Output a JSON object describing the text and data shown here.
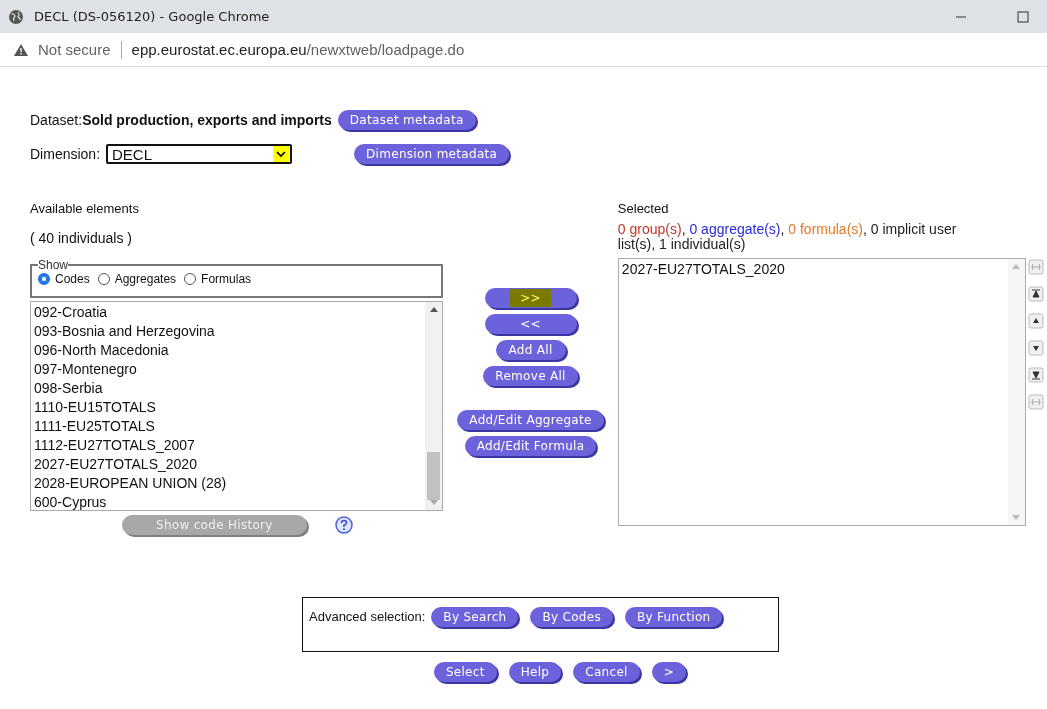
{
  "window": {
    "title": "DECL (DS-056120) - Google Chrome"
  },
  "address_bar": {
    "security": "Not secure",
    "host": "epp.eurostat.ec.europa.eu",
    "path": "/newxtweb/loadpage.do"
  },
  "dataset": {
    "label": "Dataset:",
    "name": "Sold production, exports and imports",
    "button": "Dataset metadata"
  },
  "dimension": {
    "label": "Dimension:",
    "value": "DECL",
    "button": "Dimension metadata"
  },
  "available": {
    "title": "Available elements",
    "count": "( 40 individuals )",
    "show": {
      "legend": "Show",
      "options": [
        {
          "label": "Codes",
          "selected": true
        },
        {
          "label": "Aggregates",
          "selected": false
        },
        {
          "label": "Formulas",
          "selected": false
        }
      ]
    },
    "items": [
      "092-Croatia",
      "093-Bosnia and Herzegovina",
      "096-North Macedonia",
      "097-Montenegro",
      "098-Serbia",
      "1110-EU15TOTALS",
      "1111-EU25TOTALS",
      "1112-EU27TOTALS_2007",
      "2027-EU27TOTALS_2020",
      "2028-EUROPEAN UNION (28)",
      "600-Cyprus"
    ],
    "history_button": {
      "label": "Show code History",
      "disabled": true
    }
  },
  "move_buttons": [
    {
      "label": ">>",
      "focused": true
    },
    {
      "label": "<<",
      "focused": false
    },
    {
      "label": "Add All",
      "focused": false
    },
    {
      "label": "Remove All",
      "focused": false
    }
  ],
  "edit_buttons": [
    "Add/Edit Aggregate",
    "Add/Edit Formula"
  ],
  "selected": {
    "title": "Selected",
    "summary": [
      {
        "text": "0 group(s)",
        "color": "#c0392b"
      },
      {
        "text": ", "
      },
      {
        "text": "0 aggregate(s)",
        "color": "#2b2bd6"
      },
      {
        "text": ",  "
      },
      {
        "text": "0 formula(s)",
        "color": "#e07b2a"
      },
      {
        "text": ", 0 implicit user list(s), 1 individual(s)",
        "color": "#222222"
      }
    ],
    "items": [
      "2027-EU27TOTALS_2020"
    ]
  },
  "advanced": {
    "label": "Advanced selection:",
    "buttons": [
      "By Search",
      "By Codes",
      "By Function"
    ]
  },
  "footer_buttons": [
    "Select",
    "Help",
    "Cancel",
    ">"
  ]
}
